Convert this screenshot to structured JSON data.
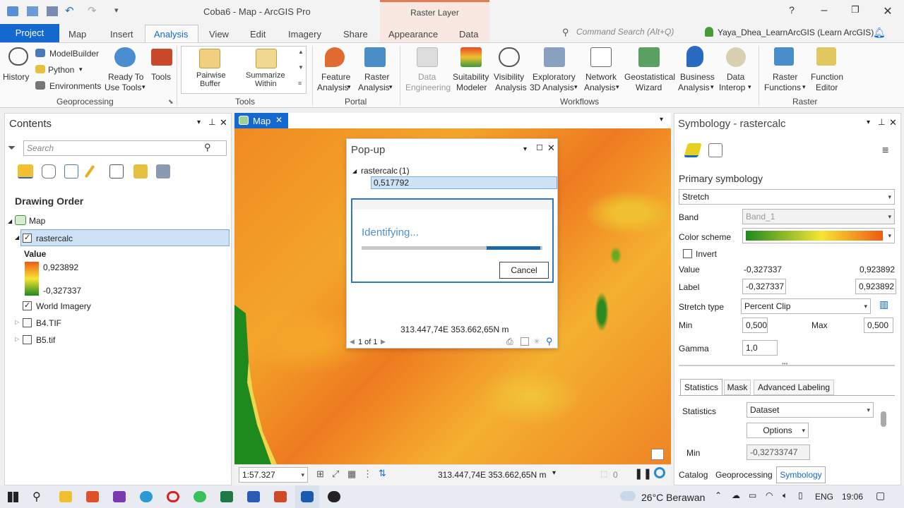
{
  "window": {
    "title": "Coba6 - Map - ArcGIS Pro",
    "context_band": "Raster Layer"
  },
  "tabs": {
    "project": "Project",
    "items": [
      "Map",
      "Insert",
      "Analysis",
      "View",
      "Edit",
      "Imagery",
      "Share",
      "Appearance",
      "Data"
    ],
    "command_search": "Command Search (Alt+Q)",
    "user": "Yaya_Dhea_LearnArcGIS (Learn ArcGIS)"
  },
  "ribbon": {
    "history": "History",
    "modelbuilder": "ModelBuilder",
    "python": "Python",
    "environments": "Environments",
    "ready_to_use_1": "Ready To",
    "ready_to_use_2": "Use Tools",
    "tools": "Tools",
    "geoprocessing": "Geoprocessing",
    "pairwise_1": "Pairwise",
    "pairwise_2": "Buffer",
    "summarize_1": "Summarize",
    "summarize_2": "Within",
    "tools_group": "Tools",
    "feature_1": "Feature",
    "feature_2": "Analysis",
    "raster_1": "Raster",
    "raster_2": "Analysis",
    "portal": "Portal",
    "data_eng_1": "Data",
    "data_eng_2": "Engineering",
    "suit_1": "Suitability",
    "suit_2": "Modeler",
    "vis_1": "Visibility",
    "vis_2": "Analysis",
    "expl_1": "Exploratory",
    "expl_2": "3D Analysis",
    "net_1": "Network",
    "net_2": "Analysis",
    "geo_1": "Geostatistical",
    "geo_2": "Wizard",
    "biz_1": "Business",
    "biz_2": "Analysis",
    "interop_1": "Data",
    "interop_2": "Interop",
    "workflows": "Workflows",
    "rf_1": "Raster",
    "rf_2": "Functions",
    "fe_1": "Function",
    "fe_2": "Editor",
    "raster_group": "Raster"
  },
  "contents": {
    "title": "Contents",
    "search_placeholder": "Search",
    "drawing_order": "Drawing Order",
    "map": "Map",
    "layer": "rastercalc",
    "value_label": "Value",
    "max": "0,923892",
    "min": "-0,327337",
    "world_imagery": "World Imagery",
    "b4": "B4.TIF",
    "b5": "B5.tif"
  },
  "map_tab": "Map",
  "popup": {
    "title": "Pop-up",
    "layer": "rastercalc",
    "count": "(1)",
    "value": "0,517792",
    "identifying": "Identifying...",
    "cancel": "Cancel",
    "coords": "313.447,74E 353.662,65N m",
    "pager": "1 of 1",
    "progress": 0.3
  },
  "map_status": {
    "scale": "1:57.327",
    "coords": "313.447,74E 353.662,65N m",
    "selected": "0"
  },
  "symbology": {
    "title": "Symbology - rastercalc",
    "primary": "Primary symbology",
    "renderer": "Stretch",
    "band_label": "Band",
    "band": "Band_1",
    "color_scheme": "Color scheme",
    "invert": "Invert",
    "value_label": "Value",
    "value_min": "-0,327337",
    "value_max": "0,923892",
    "label_label": "Label",
    "label_min": "-0,327337",
    "label_max": "0,923892",
    "stretch_type_label": "Stretch type",
    "stretch_type": "Percent Clip",
    "min_label": "Min",
    "min": "0,500",
    "max_label": "Max",
    "max": "0,500",
    "gamma_label": "Gamma",
    "gamma": "1,0",
    "tab_statistics": "Statistics",
    "tab_mask": "Mask",
    "tab_adv": "Advanced Labeling",
    "statistics_label": "Statistics",
    "statistics": "Dataset",
    "options": "Options",
    "stat_min_label": "Min",
    "stat_min": "-0,32733747"
  },
  "bottom_tabs": [
    "Catalog",
    "Geoprocessing",
    "Symbology"
  ],
  "taskbar": {
    "weather": "26°C Berawan",
    "lang": "ENG",
    "time": "19:06"
  },
  "colors": {
    "accent": "#1369d0",
    "ramp_low": "#1e8a1e",
    "ramp_mid": "#f5e632",
    "ramp_high": "#f05a14"
  }
}
